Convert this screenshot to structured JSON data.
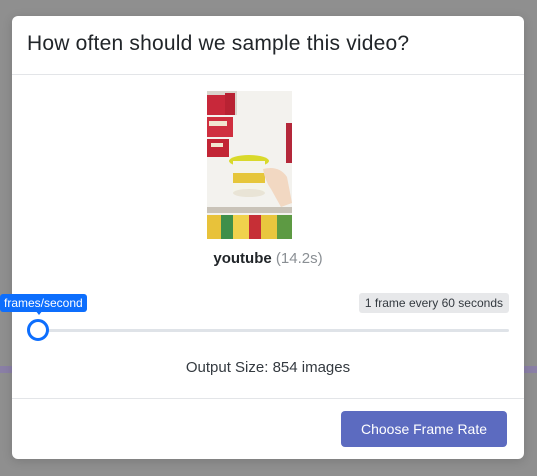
{
  "modal": {
    "title": "How often should we sample this video?"
  },
  "video": {
    "name": "youtube",
    "duration": "(14.2s)"
  },
  "sampling": {
    "rate_label": "1 frame every 60 seconds",
    "slider_tooltip": "frames/second",
    "slider_value": 0
  },
  "output": {
    "label": "Output Size: 854 images"
  },
  "footer": {
    "choose_button_label": "Choose Frame Rate"
  },
  "colors": {
    "accent": "#0d6efd",
    "primary_button": "#5c6bc0"
  }
}
